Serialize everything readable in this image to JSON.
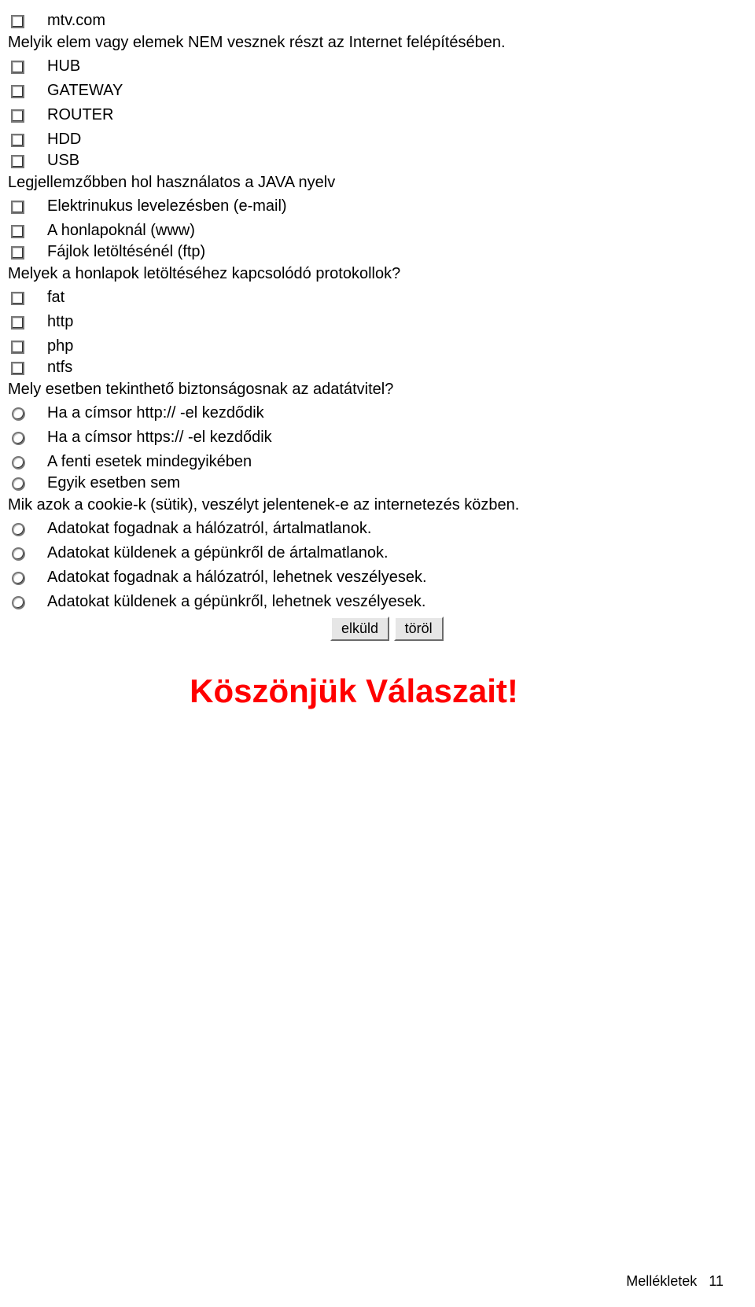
{
  "q1_opt_prev": "mtv.com",
  "q1_text": "Melyik elem vagy elemek NEM vesznek részt az Internet felépítésében.",
  "q1_opts": [
    "HUB",
    "GATEWAY",
    "ROUTER",
    "HDD",
    "USB"
  ],
  "q2_text": "Legjellemzőbben hol használatos a JAVA nyelv",
  "q2_opts": [
    "Elektrinukus levelezésben (e-mail)",
    "A honlapoknál (www)",
    "Fájlok letöltésénél (ftp)"
  ],
  "q3_text": "Melyek a honlapok letöltéséhez kapcsolódó protokollok?",
  "q3_opts": [
    "fat",
    "http",
    "php",
    "ntfs"
  ],
  "q4_text": "Mely esetben tekinthető biztonságosnak az adatátvitel?",
  "q4_opts": [
    "Ha a címsor http:// -el kezdődik",
    "Ha a címsor https:// -el kezdődik",
    "A fenti esetek mindegyikében",
    "Egyik esetben sem"
  ],
  "q5_text": "Mik azok a cookie-k (sütik), veszélyt jelentenek-e az internetezés közben.",
  "q5_opts": [
    "Adatokat fogadnak a hálózatról, ártalmatlanok.",
    "Adatokat küldenek a gépünkről de ártalmatlanok.",
    "Adatokat fogadnak a hálózatról, lehetnek veszélyesek.",
    "Adatokat küldenek a gépünkről, lehetnek veszélyesek."
  ],
  "buttons": {
    "submit": "elküld",
    "reset": "töröl"
  },
  "thanks": "Köszönjük Válaszait!",
  "footer_label": "Mellékletek",
  "footer_num": "11"
}
